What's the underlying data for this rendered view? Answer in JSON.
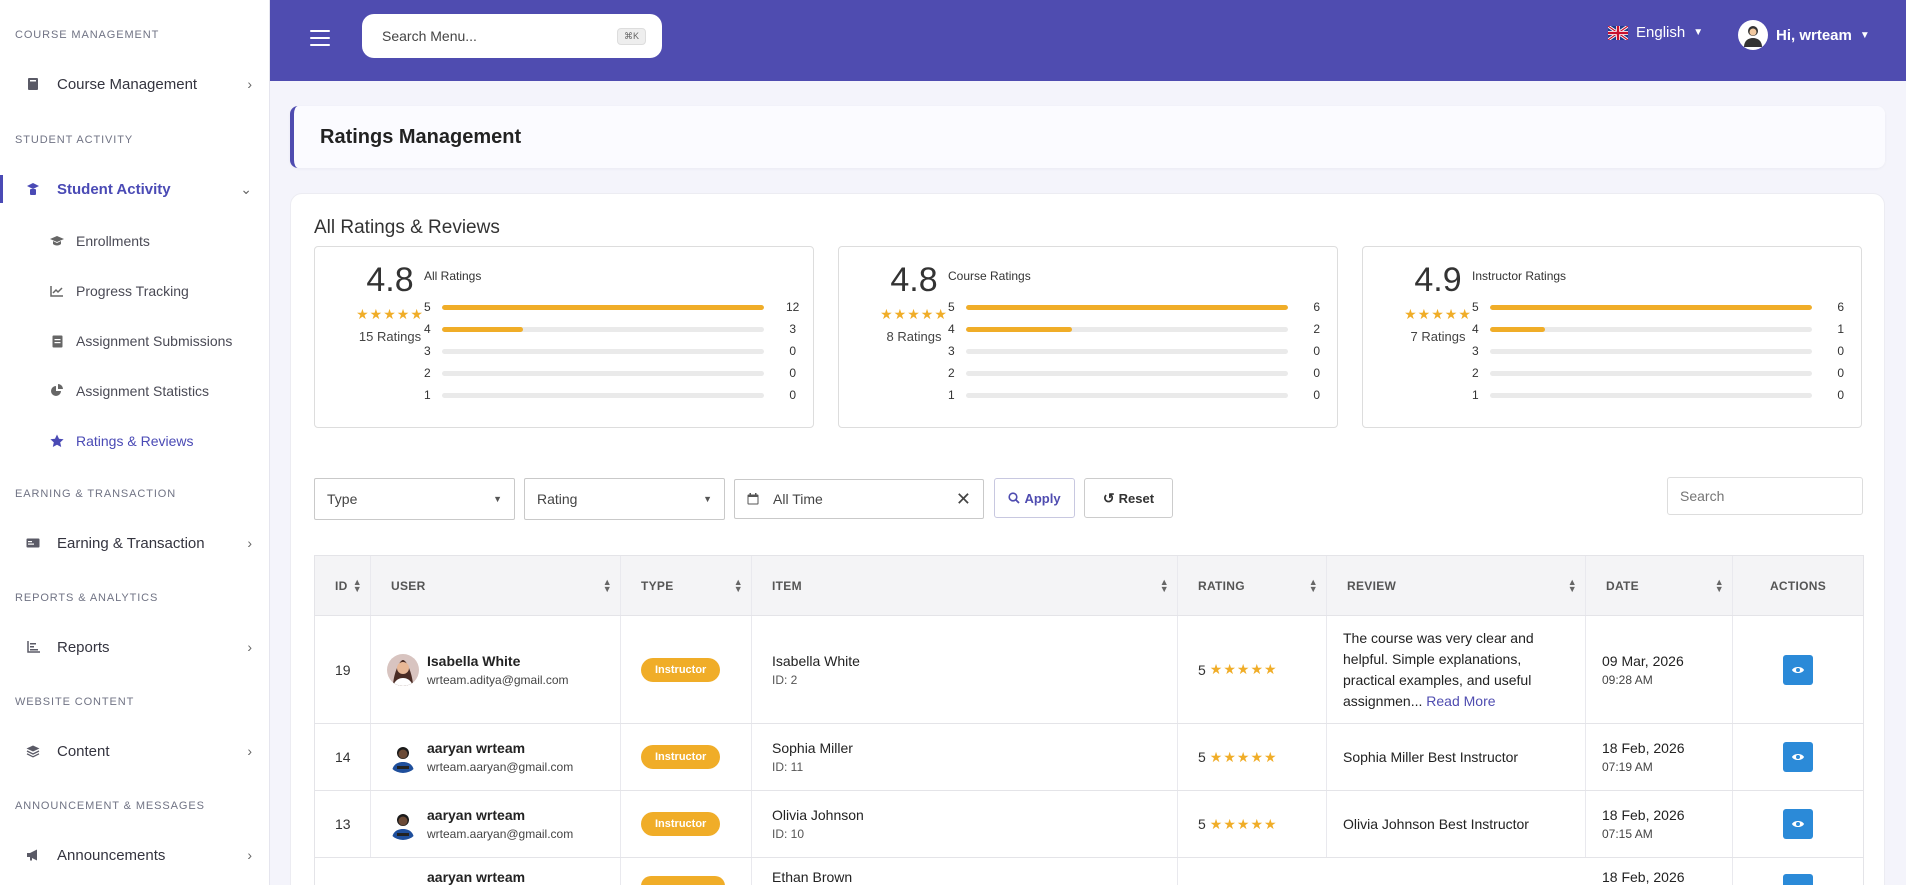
{
  "sidebar": {
    "sections": [
      {
        "title": "COURSE MANAGEMENT",
        "item": "Course Management"
      },
      {
        "title": "STUDENT ACTIVITY",
        "item": "Student Activity"
      },
      {
        "title": "EARNING & TRANSACTION",
        "item": "Earning & Transaction"
      },
      {
        "title": "REPORTS & ANALYTICS",
        "item": "Reports"
      },
      {
        "title": "WEBSITE CONTENT",
        "item": "Content"
      },
      {
        "title": "ANNOUNCEMENT & MESSAGES",
        "item": "Announcements"
      }
    ],
    "sub_items": [
      "Enrollments",
      "Progress Tracking",
      "Assignment Submissions",
      "Assignment Statistics",
      "Ratings & Reviews"
    ]
  },
  "topbar": {
    "search_placeholder": "Search Menu...",
    "search_shortcut": "⌘K",
    "language": "English",
    "user_greeting": "Hi, wrteam"
  },
  "page": {
    "title": "Ratings Management",
    "card_title": "All Ratings & Reviews"
  },
  "stats": [
    {
      "avg": "4.8",
      "count": "15 Ratings",
      "label": "All Ratings",
      "rows": [
        {
          "star": "5",
          "value": "12",
          "fraction": 1.0
        },
        {
          "star": "4",
          "value": "3",
          "fraction": 0.25
        },
        {
          "star": "3",
          "value": "0",
          "fraction": 0
        },
        {
          "star": "2",
          "value": "0",
          "fraction": 0
        },
        {
          "star": "1",
          "value": "0",
          "fraction": 0
        }
      ]
    },
    {
      "avg": "4.8",
      "count": "8 Ratings",
      "label": "Course Ratings",
      "rows": [
        {
          "star": "5",
          "value": "6",
          "fraction": 1.0
        },
        {
          "star": "4",
          "value": "2",
          "fraction": 0.33
        },
        {
          "star": "3",
          "value": "0",
          "fraction": 0
        },
        {
          "star": "2",
          "value": "0",
          "fraction": 0
        },
        {
          "star": "1",
          "value": "0",
          "fraction": 0
        }
      ]
    },
    {
      "avg": "4.9",
      "count": "7 Ratings",
      "label": "Instructor Ratings",
      "rows": [
        {
          "star": "5",
          "value": "6",
          "fraction": 1.0
        },
        {
          "star": "4",
          "value": "1",
          "fraction": 0.17
        },
        {
          "star": "3",
          "value": "0",
          "fraction": 0
        },
        {
          "star": "2",
          "value": "0",
          "fraction": 0
        },
        {
          "star": "1",
          "value": "0",
          "fraction": 0
        }
      ]
    }
  ],
  "filters": {
    "type": "Type",
    "rating": "Rating",
    "date": "All Time",
    "apply": "Apply",
    "reset": "Reset",
    "search_placeholder": "Search"
  },
  "table": {
    "headers": [
      "ID",
      "USER",
      "TYPE",
      "ITEM",
      "RATING",
      "REVIEW",
      "DATE",
      "ACTIONS"
    ],
    "rows": [
      {
        "id": "19",
        "user": "Isabella White",
        "email": "wrteam.aditya@gmail.com",
        "type": "Instructor",
        "item": "Isabella White",
        "item_id": "ID: 2",
        "rating": "5",
        "review": "The course was very clear and helpful. Simple explanations, practical examples, and useful assignmen...",
        "read_more": "Read More",
        "date": "09 Mar, 2026",
        "time": "09:28 AM"
      },
      {
        "id": "14",
        "user": "aaryan wrteam",
        "email": "wrteam.aaryan@gmail.com",
        "type": "Instructor",
        "item": "Sophia Miller",
        "item_id": "ID: 11",
        "rating": "5",
        "review": "Sophia Miller Best Instructor",
        "read_more": "",
        "date": "18 Feb, 2026",
        "time": "07:19 AM"
      },
      {
        "id": "13",
        "user": "aaryan wrteam",
        "email": "wrteam.aaryan@gmail.com",
        "type": "Instructor",
        "item": "Olivia Johnson",
        "item_id": "ID: 10",
        "rating": "5",
        "review": "Olivia Johnson Best Instructor",
        "read_more": "",
        "date": "18 Feb, 2026",
        "time": "07:15 AM"
      },
      {
        "id": "",
        "user": "aaryan wrteam",
        "email": "",
        "type": "",
        "item": "Ethan Brown",
        "item_id": "",
        "rating": "",
        "review": "",
        "read_more": "",
        "date": "18 Feb, 2026",
        "time": ""
      }
    ]
  },
  "colors": {
    "accent": "#4f4cb0",
    "star": "#f0ad28",
    "action": "#2b8ad8"
  }
}
